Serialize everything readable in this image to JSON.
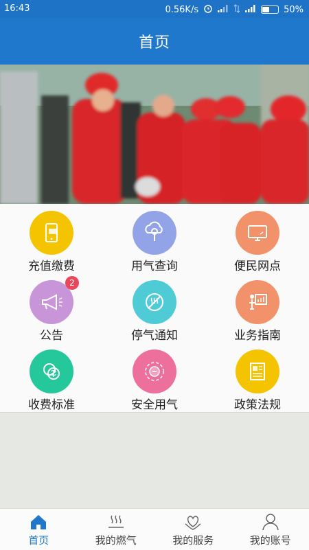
{
  "status_bar": {
    "time": "16:43",
    "speed": "0.56K/s",
    "network_small": "3G\n1X",
    "battery_percent": "50%",
    "battery_level": 0.5
  },
  "header": {
    "title": "首页"
  },
  "banner": {
    "description_icon": "workers-photo"
  },
  "grid": {
    "items": [
      {
        "label": "充值缴费",
        "icon": "card-phone-icon",
        "color": "#f5c400"
      },
      {
        "label": "用气查询",
        "icon": "cloud-search-icon",
        "color": "#93a3e8"
      },
      {
        "label": "便民网点",
        "icon": "monitor-icon",
        "color": "#f2926b"
      },
      {
        "label": "公告",
        "icon": "megaphone-icon",
        "color": "#c795d8",
        "badge": "2"
      },
      {
        "label": "停气通知",
        "icon": "no-gas-icon",
        "color": "#4fcbd6"
      },
      {
        "label": "业务指南",
        "icon": "presentation-icon",
        "color": "#f2926b"
      },
      {
        "label": "收费标准",
        "icon": "money-icon",
        "color": "#25c89a"
      },
      {
        "label": "安全用气",
        "icon": "safety-gauge-icon",
        "color": "#ec6f9c"
      },
      {
        "label": "政策法规",
        "icon": "document-icon",
        "color": "#f5c400"
      }
    ]
  },
  "tabbar": {
    "tabs": [
      {
        "label": "首页",
        "active": true
      },
      {
        "label": "我的燃气",
        "active": false
      },
      {
        "label": "我的服务",
        "active": false
      },
      {
        "label": "我的账号",
        "active": false
      }
    ],
    "active_color": "#1f78cc"
  }
}
